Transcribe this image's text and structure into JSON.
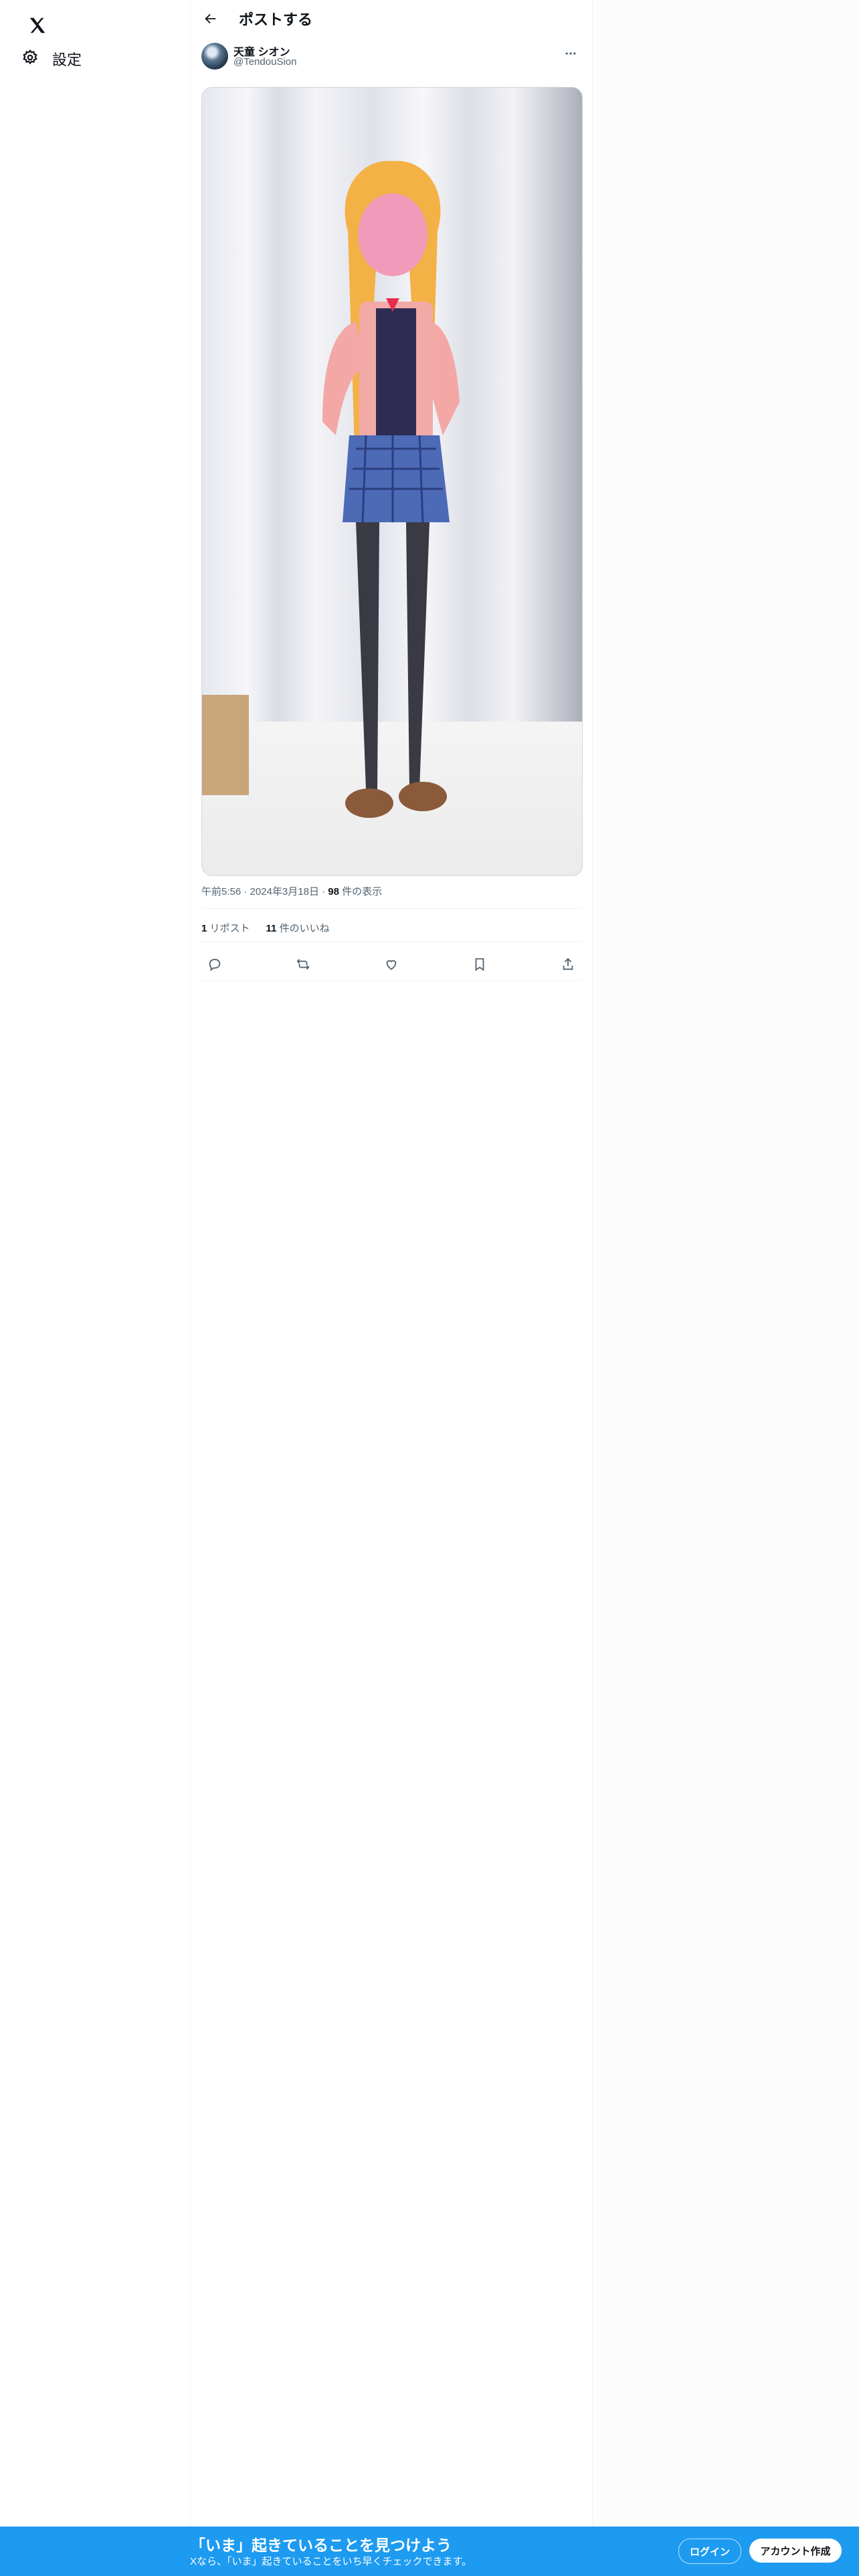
{
  "nav": {
    "settings_label": "設定"
  },
  "header": {
    "title": "ポストする"
  },
  "post": {
    "display_name": "天童 シオン",
    "handle": "@TendouSion",
    "time": "午前5:56",
    "date": "2024年3月18日",
    "views_count": "98",
    "views_label": "件の表示",
    "reposts_count": "1",
    "reposts_label": "リポスト",
    "likes_count": "11",
    "likes_label": "件のいいね"
  },
  "banner": {
    "title": "「いま」起きていることを見つけよう",
    "subtitle": "Xなら、「いま」起きていることをいち早くチェックできます。",
    "login_label": "ログイン",
    "signup_label": "アカウント作成"
  },
  "colors": {
    "accent": "#1d9bf0",
    "text": "#0f1419",
    "secondary": "#536471"
  },
  "icons": [
    "x-logo-icon",
    "gear-icon",
    "back-arrow-icon",
    "more-icon",
    "reply-icon",
    "repost-icon",
    "like-icon",
    "bookmark-icon",
    "share-icon"
  ]
}
